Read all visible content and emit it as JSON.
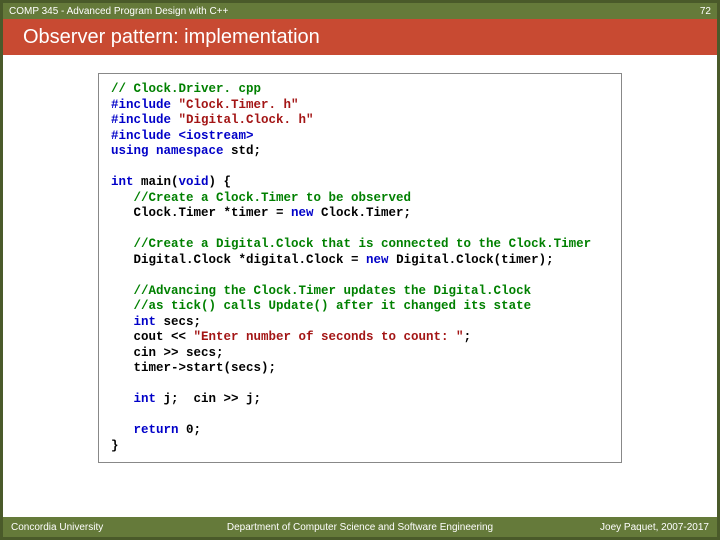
{
  "header": {
    "course": "COMP 345 - Advanced Program Design with C++",
    "page_number": "72"
  },
  "title": "Observer pattern: implementation",
  "code": {
    "l1_cm": "// Clock.Driver. cpp",
    "l2a_kw": "#include ",
    "l2b_st": "\"Clock.Timer. h\"",
    "l3a_kw": "#include ",
    "l3b_st": "\"Digital.Clock. h\"",
    "l4_kw": "#include <iostream>",
    "l5a_kw": "using namespace",
    "l5b": " std;",
    "l7a_kw": "int",
    "l7b": " main(",
    "l7c_kw": "void",
    "l7d": ") {",
    "l8_cm": "   //Create a Clock.Timer to be observed",
    "l9a": "   Clock.Timer *timer = ",
    "l9b_kw": "new",
    "l9c": " Clock.Timer;",
    "l11_cm": "   //Create a Digital.Clock that is connected to the Clock.Timer",
    "l12a": "   Digital.Clock *digital.Clock = ",
    "l12b_kw": "new",
    "l12c": " Digital.Clock(timer);",
    "l14_cm": "   //Advancing the Clock.Timer updates the Digital.Clock",
    "l15_cm": "   //as tick() calls Update() after it changed its state",
    "l16a": "   ",
    "l16b_kw": "int",
    "l16c": " secs;",
    "l17a": "   cout << ",
    "l17b_st": "\"Enter number of seconds to count: \"",
    "l17c": ";",
    "l18": "   cin >> secs;",
    "l19": "   timer->start(secs);",
    "l21a": "   ",
    "l21b_kw": "int",
    "l21c": " j;  cin >> j;",
    "l23a": "   ",
    "l23b_kw": "return",
    "l23c": " 0;",
    "l24": "}"
  },
  "footer": {
    "left": "Concordia University",
    "center": "Department of Computer Science and Software Engineering",
    "right": "Joey Paquet, 2007-2017"
  }
}
